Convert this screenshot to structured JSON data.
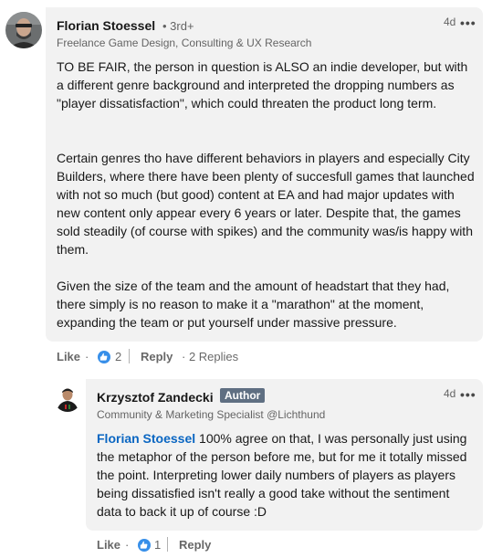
{
  "comment": {
    "author": "Florian Stoessel",
    "degree": "• 3rd+",
    "headline": "Freelance Game Design, Consulting & UX Research",
    "time": "4d",
    "more": "•••",
    "paragraphs": [
      "TO BE FAIR, the person in question is ALSO an indie developer, but with a different genre background and interpreted the dropping numbers as \"player dissatisfaction\", which could threaten the product long term.",
      "Certain genres tho have different behaviors in players and especially City Builders, where there have been plenty of succesfull games that launched with not so much (but good) content at EA and had major updates with new content only appear every 6 years or later. Despite that, the games sold steadily (of course with spikes) and the community was/is happy with them.",
      "Given the size of the team and the amount of headstart that they had, there simply is no reason to make it a \"marathon\" at the moment, expanding the team or put yourself under massive pressure."
    ],
    "actions": {
      "like": "Like",
      "dot": "·",
      "like_count": "2",
      "reply": "Reply",
      "replies": "· 2 Replies"
    }
  },
  "reply": {
    "author": "Krzysztof Zandecki",
    "badge": "Author",
    "headline": "Community & Marketing Specialist @Lichthund",
    "time": "4d",
    "more": "•••",
    "mention": "Florian Stoessel",
    "text": " 100% agree on that, I was personally just using the metaphor of the person before me, but for me it totally missed the point. Interpreting lower daily numbers of players as players being dissatisfied isn't really a good take without the sentiment data to back it up of course :D",
    "actions": {
      "like": "Like",
      "dot": "·",
      "like_count": "1",
      "reply": "Reply"
    }
  },
  "colors": {
    "bubble": "#f2f2f2",
    "link": "#0a66c2",
    "like_icon": "#378fe9",
    "badge": "#5f6f82"
  }
}
